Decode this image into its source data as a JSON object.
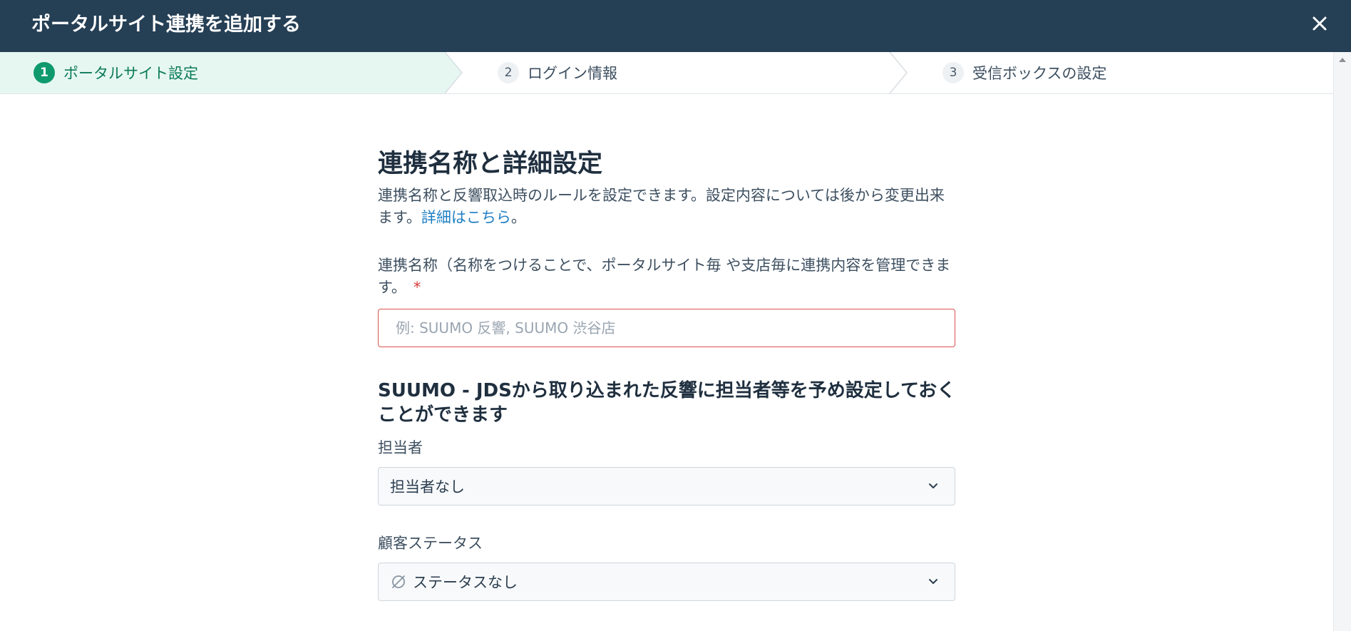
{
  "modal": {
    "title": "ポータルサイト連携を追加する"
  },
  "stepper": {
    "steps": [
      {
        "number": "1",
        "label": "ポータルサイト設定",
        "state": "active"
      },
      {
        "number": "2",
        "label": "ログイン情報",
        "state": "inactive"
      },
      {
        "number": "3",
        "label": "受信ボックスの設定",
        "state": "inactive"
      }
    ]
  },
  "section": {
    "title": "連携名称と詳細設定",
    "description_prefix": "連携名称と反響取込時のルールを設定できます。設定内容については後から変更出来ます。",
    "description_link": "詳細はこちら",
    "description_suffix": "。"
  },
  "name_field": {
    "label": "連携名称（名称をつけることで、ポータルサイト毎 や支店毎に連携内容を管理できます。",
    "required_mark": "*",
    "value": "",
    "placeholder": "例: SUUMO 反響, SUUMO 渋谷店"
  },
  "defaults_section": {
    "title": "SUUMO - JDSから取り込まれた反響に担当者等を予め設定しておくことができます"
  },
  "assignee_field": {
    "label": "担当者",
    "value": "担当者なし"
  },
  "status_field": {
    "label": "顧客ステータス",
    "value": "ステータスなし",
    "icon": "empty-set-icon"
  },
  "icons": {
    "close": "close-icon",
    "chevron": "chevron-down-icon",
    "scroll": "scroll-up-arrow-icon"
  },
  "colors": {
    "header_bg": "#253f55",
    "active_step_bg": "#e6f7f1",
    "active_step_accent": "#0f9a6e",
    "error_border": "#d9534f",
    "link": "#1f7fc4",
    "required": "#d93a3a"
  }
}
